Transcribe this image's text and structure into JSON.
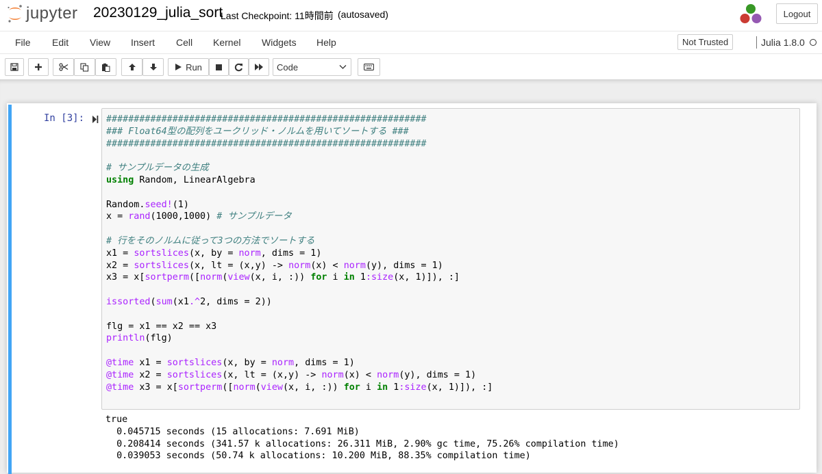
{
  "header": {
    "logo_text": "jupyter",
    "notebook_name": "20230129_julia_sort",
    "checkpoint": "Last Checkpoint: 11時間前",
    "autosave": "(autosaved)",
    "logout_label": "Logout"
  },
  "menubar": {
    "items": [
      "File",
      "Edit",
      "View",
      "Insert",
      "Cell",
      "Kernel",
      "Widgets",
      "Help"
    ],
    "trust_status": "Not Trusted",
    "kernel_name": "Julia 1.8.0"
  },
  "toolbar": {
    "run_label": "Run",
    "cell_type": "Code",
    "buttons": [
      "save-icon",
      "plus-icon",
      "cut-icon",
      "copy-icon",
      "paste-icon",
      "arrow-up-icon",
      "arrow-down-icon",
      "run-icon",
      "stop-icon",
      "restart-icon",
      "fast-forward-icon",
      "keyboard-icon"
    ]
  },
  "cell": {
    "prompt": "In [3]:",
    "code_lines": [
      "##########################################################",
      "### Float64型の配列をユークリッド・ノルムを用いてソートする ###",
      "##########################################################",
      "",
      "# サンプルデータの生成",
      "using Random, LinearAlgebra",
      "",
      "Random.seed!(1)",
      "x = rand(1000,1000) # サンプルデータ",
      "",
      "# 行をそのノルムに従って3つの方法でソートする",
      "x1 = sortslices(x, by = norm, dims = 1)",
      "x2 = sortslices(x, lt = (x,y) -> norm(x) < norm(y), dims = 1)",
      "x3 = x[sortperm([norm(view(x, i, :)) for i in 1:size(x, 1)]), :]",
      "",
      "issorted(sum(x1.^2, dims = 2))",
      "",
      "flg = x1 == x2 == x3",
      "println(flg)",
      "",
      "@time x1 = sortslices(x, by = norm, dims = 1)",
      "@time x2 = sortslices(x, lt = (x,y) -> norm(x) < norm(y), dims = 1)",
      "@time x3 = x[sortperm([norm(view(x, i, :)) for i in 1:size(x, 1)]), :]"
    ],
    "output_lines": [
      "true",
      "  0.045715 seconds (15 allocations: 7.691 MiB)",
      "  0.208414 seconds (341.57 k allocations: 26.311 MiB, 2.90% gc time, 75.26% compilation time)",
      "  0.039053 seconds (50.74 k allocations: 10.200 MiB, 88.35% compilation time)"
    ]
  },
  "colors": {
    "cell_border": "#42a5f5",
    "prompt": "#303f9f",
    "comment": "#408080",
    "keyword": "#008000",
    "builtin": "#aa22ff",
    "logo_orange": "#f37726"
  }
}
